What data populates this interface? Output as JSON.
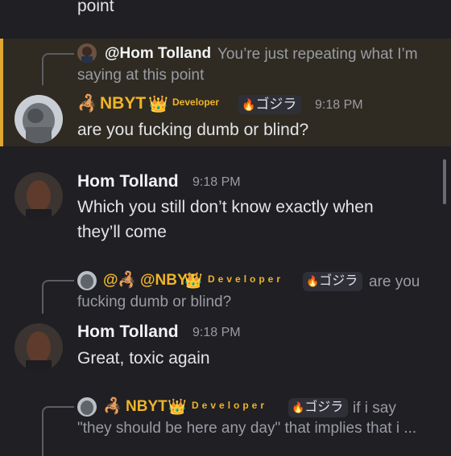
{
  "colors": {
    "background": "#1f1f24",
    "highlight": "#2f2b22",
    "highlight_bar": "#e0a82e",
    "gold": "#f0b429",
    "muted": "#9a9ca3"
  },
  "top_fragment": "point",
  "msg1": {
    "reply_author": "@Hom Tolland",
    "reply_text_line1": "You’re just repeating what I’m",
    "reply_text_line2": "saying at this point",
    "author": "NBYT",
    "role": "Developer",
    "tag": "ゴジラ",
    "time": "9:18 PM",
    "text": "are you fucking dumb or blind?"
  },
  "msg2": {
    "author": "Hom Tolland",
    "time": "9:18 PM",
    "text_line1": "Which you still don’t know exactly when",
    "text_line2": "they’ll come"
  },
  "msg3": {
    "reply_author": "@NBYT",
    "reply_role": "Developer",
    "reply_tag": "ゴジラ",
    "reply_text_line1": "are you",
    "reply_text_line2": "fucking dumb or blind?",
    "author": "Hom Tolland",
    "time": "9:18 PM",
    "text": "Great, toxic again"
  },
  "msg4": {
    "reply_author": "NBYT",
    "reply_role": "Developer",
    "reply_tag": "ゴジラ",
    "reply_text_line1": "if i say",
    "reply_text_line2": "\"they should be here any day\" that implies that i ..."
  },
  "icons": {
    "scorpion": "scorpion-emoji",
    "crown": "crown-emoji",
    "flame": "blue-flame-icon"
  }
}
